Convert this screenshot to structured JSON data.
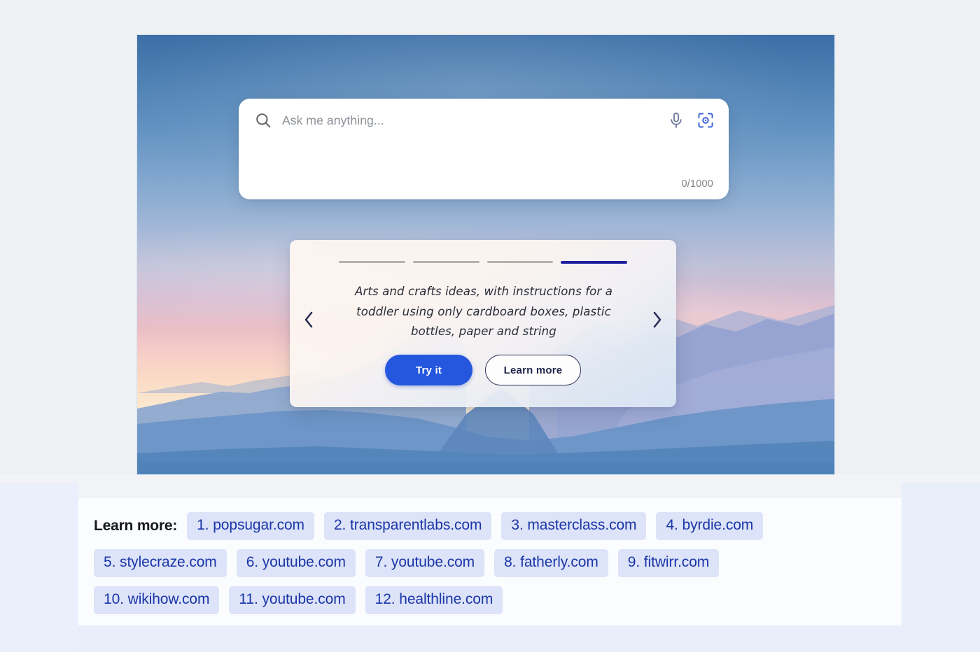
{
  "hero": {
    "alt_description": "sunset-sky-over-mountains-background"
  },
  "search": {
    "placeholder": "Ask me anything...",
    "value": "",
    "counter": "0/1000",
    "icons": {
      "search": "search-icon",
      "mic": "microphone-icon",
      "lens": "camera-lens-icon"
    }
  },
  "carousel": {
    "slide_text": "Arts and crafts ideas, with instructions for a toddler using only cardboard boxes, plastic bottles, paper and string",
    "total_slides": 4,
    "active_slide": 4,
    "prev_label": "‹",
    "next_label": "›",
    "buttons": {
      "primary": "Try it",
      "secondary": "Learn more"
    },
    "accent_active": "#1f1f9e",
    "accent_inactive": "#b6b1ad"
  },
  "sources": {
    "label": "Learn more:",
    "chip_bg": "#dde3f8",
    "chip_text_color": "#1a36a8",
    "rows": [
      [
        "1. popsugar.com",
        "2. transparentlabs.com",
        "3. masterclass.com",
        "4. byrdie.com"
      ],
      [
        "5. stylecraze.com",
        "6. youtube.com",
        "7. youtube.com",
        "8. fatherly.com",
        "9. fitwirr.com"
      ],
      [
        "10. wikihow.com",
        "11. youtube.com",
        "12. healthline.com"
      ]
    ]
  }
}
